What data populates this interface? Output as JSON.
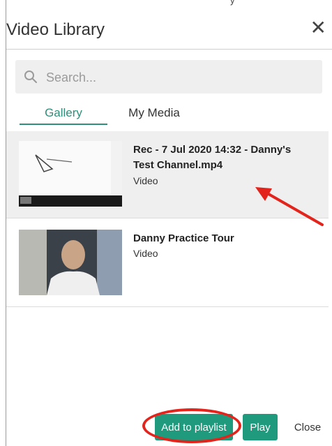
{
  "topstrip": {
    "text": "y"
  },
  "header": {
    "title": "Video Library",
    "close_icon": "close-icon"
  },
  "search": {
    "placeholder": "Search...",
    "value": ""
  },
  "tabs": [
    {
      "label": "Gallery",
      "active": true
    },
    {
      "label": "My Media",
      "active": false
    }
  ],
  "items": [
    {
      "title": "Rec - 7 Jul 2020 14:32 - Danny's Test Channel.mp4",
      "type": "Video",
      "selected": true
    },
    {
      "title": "Danny Practice Tour",
      "type": "Video",
      "selected": false
    }
  ],
  "footer": {
    "add_label": "Add to playlist",
    "play_label": "Play",
    "close_label": "Close"
  },
  "colors": {
    "accent": "#1f9a7c",
    "annotation": "#e3241c"
  }
}
